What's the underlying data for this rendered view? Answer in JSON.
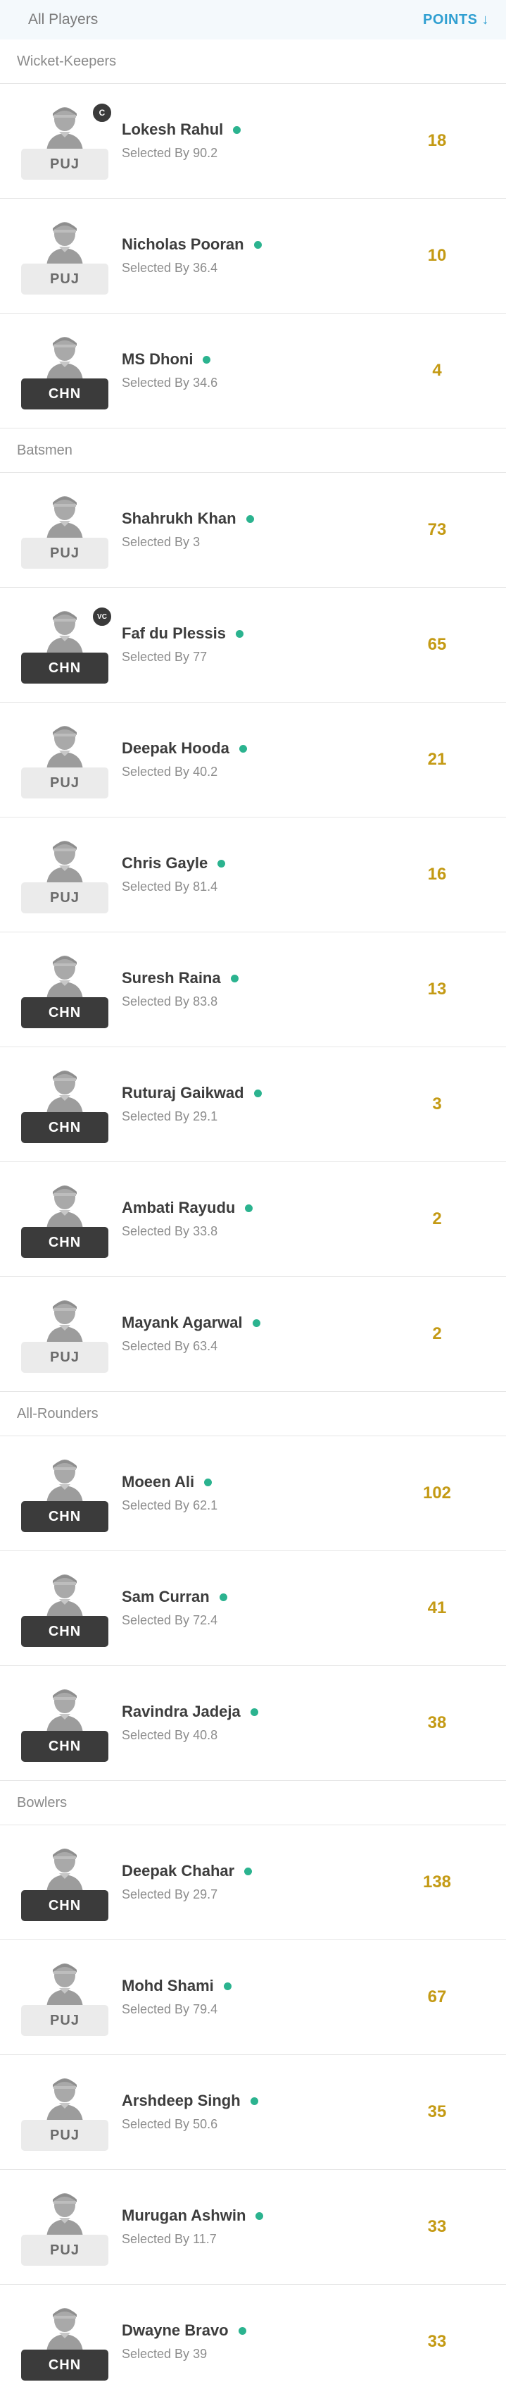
{
  "header": {
    "title": "All Players",
    "sort_label": "POINTS",
    "sort_arrow": "↓"
  },
  "selected_prefix": "Selected By",
  "colors": {
    "points": "#c49a14",
    "playing_dot": "#2bb38f",
    "sort_link": "#2f9fd1",
    "team_dark_tag": "#3b3b3b",
    "team_light_tag": "#ebebeb"
  },
  "icons": {
    "player_avatar": "person-silhouette-icon",
    "playing_indicator": "green-dot-icon"
  },
  "sections": [
    {
      "title": "Wicket-Keepers",
      "players": [
        {
          "name": "Lokesh Rahul",
          "team": "PUJ",
          "selected": "90.2",
          "points": "18",
          "badge": "C"
        },
        {
          "name": "Nicholas Pooran",
          "team": "PUJ",
          "selected": "36.4",
          "points": "10",
          "badge": ""
        },
        {
          "name": "MS Dhoni",
          "team": "CHN",
          "selected": "34.6",
          "points": "4",
          "badge": ""
        }
      ]
    },
    {
      "title": "Batsmen",
      "players": [
        {
          "name": "Shahrukh Khan",
          "team": "PUJ",
          "selected": "3",
          "points": "73",
          "badge": ""
        },
        {
          "name": "Faf du Plessis",
          "team": "CHN",
          "selected": "77",
          "points": "65",
          "badge": "VC"
        },
        {
          "name": "Deepak Hooda",
          "team": "PUJ",
          "selected": "40.2",
          "points": "21",
          "badge": ""
        },
        {
          "name": "Chris Gayle",
          "team": "PUJ",
          "selected": "81.4",
          "points": "16",
          "badge": ""
        },
        {
          "name": "Suresh Raina",
          "team": "CHN",
          "selected": "83.8",
          "points": "13",
          "badge": ""
        },
        {
          "name": "Ruturaj Gaikwad",
          "team": "CHN",
          "selected": "29.1",
          "points": "3",
          "badge": ""
        },
        {
          "name": "Ambati Rayudu",
          "team": "CHN",
          "selected": "33.8",
          "points": "2",
          "badge": ""
        },
        {
          "name": "Mayank Agarwal",
          "team": "PUJ",
          "selected": "63.4",
          "points": "2",
          "badge": ""
        }
      ]
    },
    {
      "title": "All-Rounders",
      "players": [
        {
          "name": "Moeen Ali",
          "team": "CHN",
          "selected": "62.1",
          "points": "102",
          "badge": ""
        },
        {
          "name": "Sam Curran",
          "team": "CHN",
          "selected": "72.4",
          "points": "41",
          "badge": ""
        },
        {
          "name": "Ravindra Jadeja",
          "team": "CHN",
          "selected": "40.8",
          "points": "38",
          "badge": ""
        }
      ]
    },
    {
      "title": "Bowlers",
      "players": [
        {
          "name": "Deepak Chahar",
          "team": "CHN",
          "selected": "29.7",
          "points": "138",
          "badge": ""
        },
        {
          "name": "Mohd Shami",
          "team": "PUJ",
          "selected": "79.4",
          "points": "67",
          "badge": ""
        },
        {
          "name": "Arshdeep Singh",
          "team": "PUJ",
          "selected": "50.6",
          "points": "35",
          "badge": ""
        },
        {
          "name": "Murugan Ashwin",
          "team": "PUJ",
          "selected": "11.7",
          "points": "33",
          "badge": ""
        },
        {
          "name": "Dwayne Bravo",
          "team": "CHN",
          "selected": "39",
          "points": "33",
          "badge": ""
        }
      ]
    }
  ]
}
